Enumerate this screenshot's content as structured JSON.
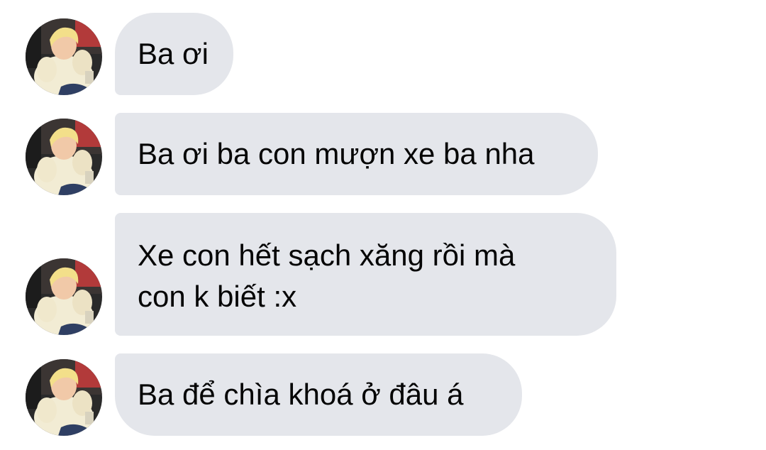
{
  "conversation": {
    "messages": [
      {
        "text": "Ba ơi"
      },
      {
        "text": "Ba ơi ba con mượn xe ba nha"
      },
      {
        "text": "Xe con hết sạch xăng rồi mà\ncon k biết :x"
      },
      {
        "text": "Ba để chìa khoá ở đâu á"
      }
    ]
  },
  "colors": {
    "bubble_background": "#e4e6eb",
    "text": "#050505",
    "page_background": "#ffffff"
  },
  "icons": {
    "avatar": "avatar"
  }
}
